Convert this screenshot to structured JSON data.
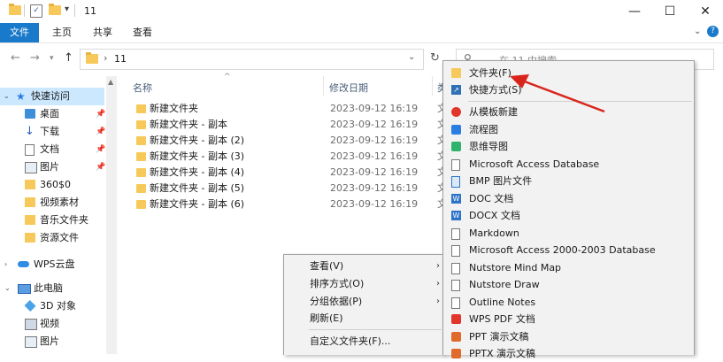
{
  "window": {
    "title": "11",
    "buttons": {
      "minimize": "—",
      "maximize": "☐",
      "close": "✕"
    }
  },
  "ribbon": {
    "tabs": [
      "文件",
      "主页",
      "共享",
      "查看"
    ],
    "accent": "#1979ca"
  },
  "address": {
    "path_sep": "›",
    "path": "11",
    "search_placeholder": "在 11 中搜索"
  },
  "nav_pane": {
    "items": [
      {
        "label": "快速访问",
        "icon": "star-icon",
        "pinned": false
      },
      {
        "label": "桌面",
        "icon": "desktop-icon",
        "pinned": true
      },
      {
        "label": "下载",
        "icon": "download-icon",
        "pinned": true
      },
      {
        "label": "文档",
        "icon": "document-icon",
        "pinned": true
      },
      {
        "label": "图片",
        "icon": "picture-icon",
        "pinned": true
      },
      {
        "label": "360$0",
        "icon": "folder-icon",
        "pinned": false
      },
      {
        "label": "视频素材",
        "icon": "folder-icon",
        "pinned": false
      },
      {
        "label": "音乐文件夹",
        "icon": "folder-icon",
        "pinned": false
      },
      {
        "label": "资源文件",
        "icon": "folder-icon",
        "pinned": false
      },
      {
        "label": "WPS云盘",
        "icon": "cloud-icon",
        "pinned": false
      },
      {
        "label": "此电脑",
        "icon": "pc-icon",
        "pinned": false
      },
      {
        "label": "3D 对象",
        "icon": "cube-icon",
        "pinned": false
      },
      {
        "label": "视频",
        "icon": "video-icon",
        "pinned": false
      },
      {
        "label": "图片",
        "icon": "picture-icon",
        "pinned": false
      }
    ]
  },
  "file_list": {
    "columns": {
      "name": "名称",
      "date": "修改日期",
      "type": "类"
    },
    "rows": [
      {
        "name": "新建文件夹",
        "date": "2023-09-12 16:19",
        "type": "文"
      },
      {
        "name": "新建文件夹 - 副本",
        "date": "2023-09-12 16:19",
        "type": "文"
      },
      {
        "name": "新建文件夹 - 副本 (2)",
        "date": "2023-09-12 16:19",
        "type": "文"
      },
      {
        "name": "新建文件夹 - 副本 (3)",
        "date": "2023-09-12 16:19",
        "type": "文"
      },
      {
        "name": "新建文件夹 - 副本 (4)",
        "date": "2023-09-12 16:19",
        "type": "文"
      },
      {
        "name": "新建文件夹 - 副本 (5)",
        "date": "2023-09-12 16:19",
        "type": "文"
      },
      {
        "name": "新建文件夹 - 副本 (6)",
        "date": "2023-09-12 16:19",
        "type": "文"
      }
    ]
  },
  "context_menu": {
    "items": [
      {
        "label": "查看(V)",
        "submenu": true
      },
      {
        "label": "排序方式(O)",
        "submenu": true
      },
      {
        "label": "分组依据(P)",
        "submenu": true
      },
      {
        "label": "刷新(E)",
        "submenu": false
      },
      {
        "label": "自定义文件夹(F)...",
        "submenu": false
      }
    ]
  },
  "new_submenu": {
    "items": [
      {
        "label": "文件夹(F)",
        "icon": "folder-icon",
        "color": "#f6c95a"
      },
      {
        "label": "快捷方式(S)",
        "icon": "shortcut-icon",
        "color": "#2f6fb5"
      },
      {
        "label": "从模板新建",
        "icon": "wps-template-icon",
        "color": "#e0362c"
      },
      {
        "label": "流程图",
        "icon": "flowchart-icon",
        "color": "#2a7de1"
      },
      {
        "label": "思维导图",
        "icon": "mindmap-icon",
        "color": "#2fb36c"
      },
      {
        "label": "Microsoft Access Database",
        "icon": "blank-file-icon",
        "color": "#ffffff"
      },
      {
        "label": "BMP 图片文件",
        "icon": "image-file-icon",
        "color": "#2d73c8"
      },
      {
        "label": "DOC 文档",
        "icon": "word-doc-icon",
        "color": "#2d73c8"
      },
      {
        "label": "DOCX 文档",
        "icon": "word-docx-icon",
        "color": "#2d73c8"
      },
      {
        "label": "Markdown",
        "icon": "blank-file-icon",
        "color": "#ffffff"
      },
      {
        "label": "Microsoft Access 2000-2003 Database",
        "icon": "blank-file-icon",
        "color": "#ffffff"
      },
      {
        "label": "Nutstore Mind Map",
        "icon": "blank-file-icon",
        "color": "#ffffff"
      },
      {
        "label": "Nutstore Draw",
        "icon": "blank-file-icon",
        "color": "#ffffff"
      },
      {
        "label": "Outline Notes",
        "icon": "blank-file-icon",
        "color": "#ffffff"
      },
      {
        "label": "WPS PDF 文档",
        "icon": "pdf-icon",
        "color": "#e0362c"
      },
      {
        "label": "PPT 演示文稿",
        "icon": "ppt-icon",
        "color": "#e06a2c"
      },
      {
        "label": "PPTX 演示文稿",
        "icon": "pptx-icon",
        "color": "#e06a2c"
      }
    ]
  },
  "annotation_color": "#d9241c"
}
